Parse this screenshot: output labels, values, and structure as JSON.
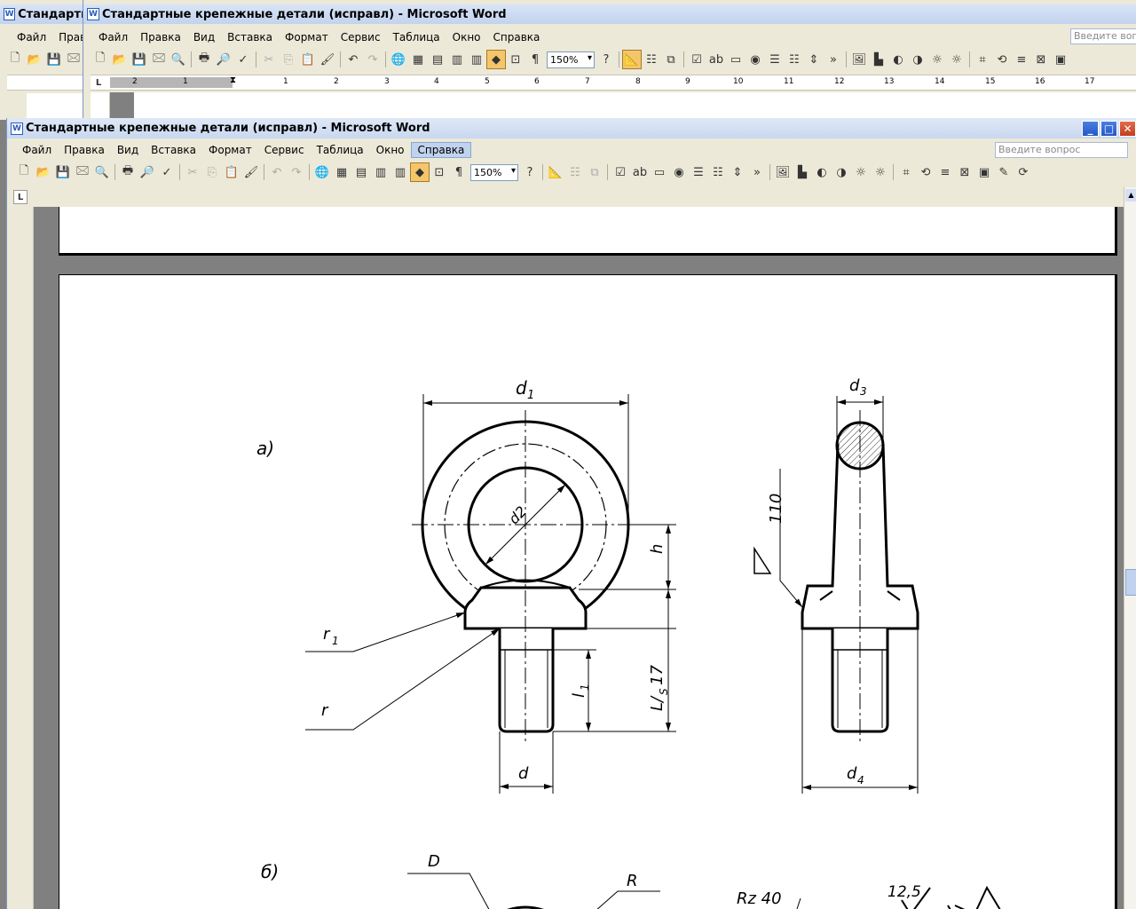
{
  "back_window": {
    "title": "Стандартные крепежные детали (исправл) - Microsoft Word",
    "title_cut": "Стандартн",
    "menu_cut": [
      "Файл",
      "Правк"
    ]
  },
  "mid_window": {
    "title": "Стандартные крепежные детали (исправл) - Microsoft Word",
    "menu": [
      "Файл",
      "Правка",
      "Вид",
      "Вставка",
      "Формат",
      "Сервис",
      "Таблица",
      "Окно",
      "Справка"
    ],
    "ask_placeholder": "Введите вопрос",
    "zoom": "150%",
    "ruler_left": [
      "2",
      "1"
    ],
    "ruler_right": [
      "1",
      "2",
      "3",
      "4",
      "5",
      "6",
      "7",
      "8",
      "9",
      "10",
      "11",
      "12",
      "13",
      "14",
      "15",
      "16",
      "17"
    ]
  },
  "main_window": {
    "title": "Стандартные крепежные детали (исправл) - Microsoft Word",
    "menu": [
      "Файл",
      "Правка",
      "Вид",
      "Вставка",
      "Формат",
      "Сервис",
      "Таблица",
      "Окно",
      "Справка"
    ],
    "active_menu": "Справка",
    "ask_placeholder": "Введите вопрос",
    "zoom": "150%"
  },
  "drawing": {
    "label_a": "а)",
    "label_b": "б)",
    "d1": "d",
    "d1_sub": "1",
    "d2": "d2",
    "d3": "d",
    "d3_sub": "3",
    "d4": "d",
    "d4_sub": "4",
    "h": "h",
    "r1": "r",
    "r1_sub": "1",
    "r": "r",
    "l1": "l",
    "l1_sub": "1",
    "l_js17": "L/",
    "l_js17_sub": "S",
    "l_js17_tail": "17",
    "d": "d",
    "roughness": "110",
    "b_D": "D",
    "b_R": "R",
    "b_rz": "Rz 40",
    "b_12_5": "12,5"
  },
  "colors": {
    "titlebar_text": "#000000",
    "close_button": "#c23d1c",
    "control_button": "#2456c8",
    "page_border": "#000000"
  }
}
